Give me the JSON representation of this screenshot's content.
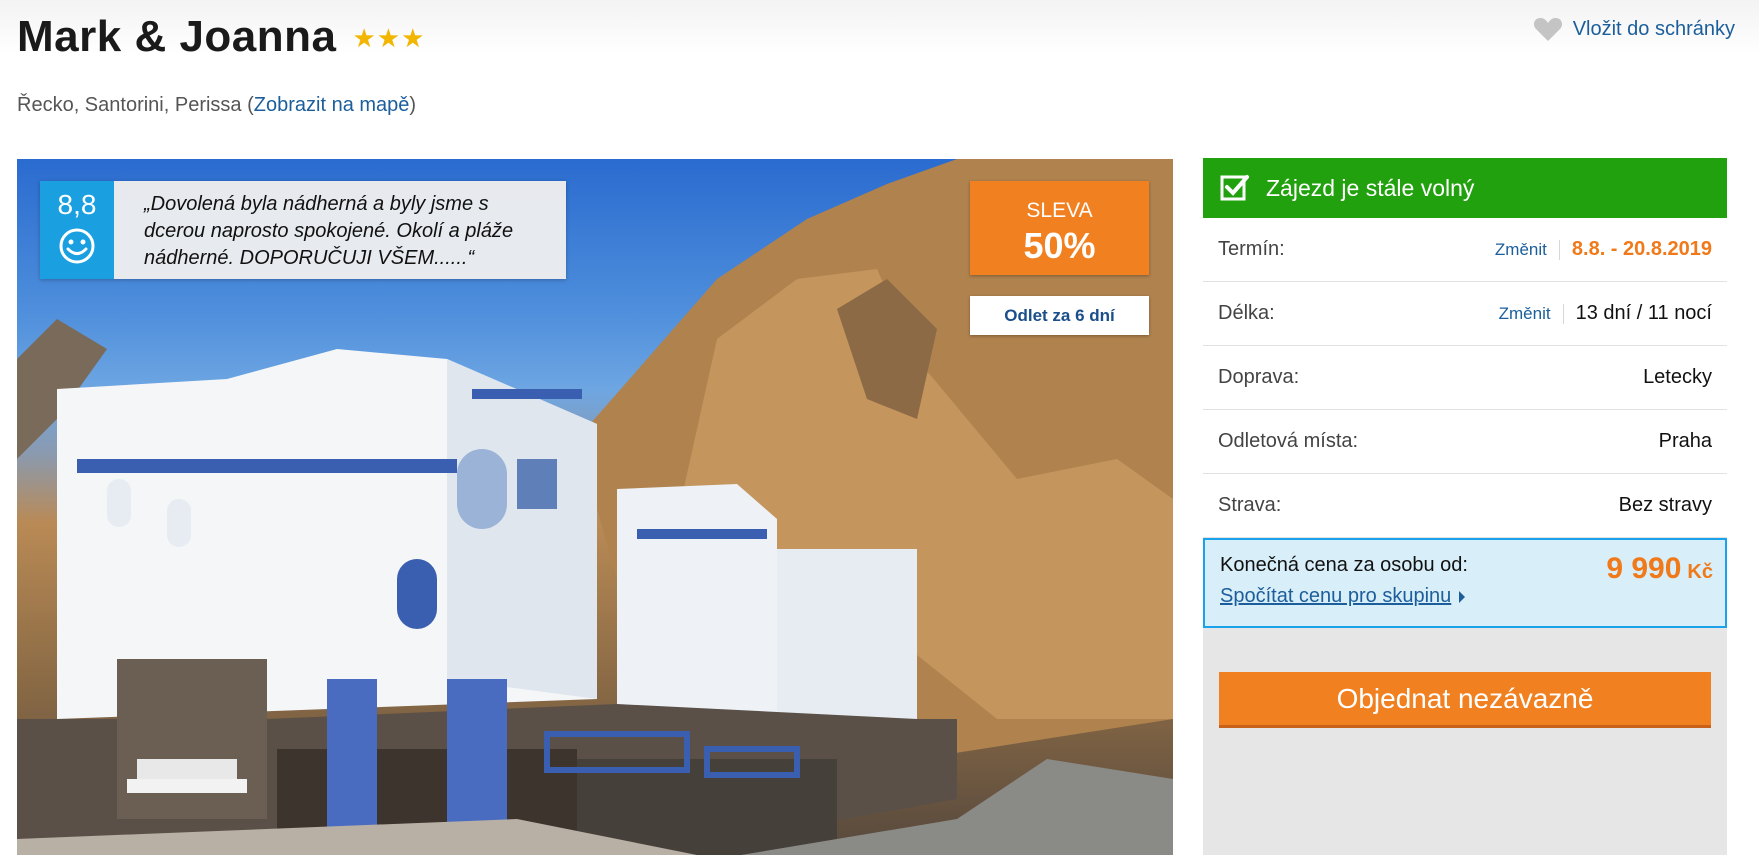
{
  "header": {
    "title": "Mark & Joanna",
    "stars": "★★★",
    "stars_count": 3,
    "favorite_label": "Vložit do schránky",
    "favorite_icon": "heart-icon"
  },
  "location": {
    "text": "Řecko, Santorini, Perissa",
    "open_paren": " (",
    "map_link": "Zobrazit na mapě",
    "close_paren": ")"
  },
  "photo": {
    "review": {
      "score": "8,8",
      "face_icon": "smiley-icon",
      "quote": "„Dovolená byla nádherná a byly jsme s dcerou naprosto spokojené. Okolí a pláže nádherné. DOPORUČUJI VŠEM......“"
    },
    "discount": {
      "label": "SLEVA",
      "value": "50%"
    },
    "departure_badge": "Odlet za 6 dní"
  },
  "sidebar": {
    "availability": "Zájezd je stále volný",
    "availability_icon": "checkbox-icon",
    "rows": [
      {
        "label": "Termín:",
        "change": "Změnit",
        "value": "8.8. - 20.8.2019"
      },
      {
        "label": "Délka:",
        "change": "Změnit",
        "value": "13 dní / 11 nocí"
      },
      {
        "label": "Doprava:",
        "value": "Letecky"
      },
      {
        "label": "Odletová místa:",
        "value": "Praha"
      },
      {
        "label": "Strava:",
        "value": "Bez stravy"
      }
    ],
    "price": {
      "label": "Konečná cena za osobu od:",
      "amount": "9 990",
      "currency": "Kč",
      "group_link": "Spočítat cenu pro skupinu"
    },
    "order_button": "Objednat nezávazně"
  },
  "colors": {
    "accent_orange": "#f08020",
    "available_green": "#22a10f",
    "link_blue": "#1b5e9b",
    "rating_blue": "#1a9fe0",
    "star_gold": "#f2b500"
  }
}
